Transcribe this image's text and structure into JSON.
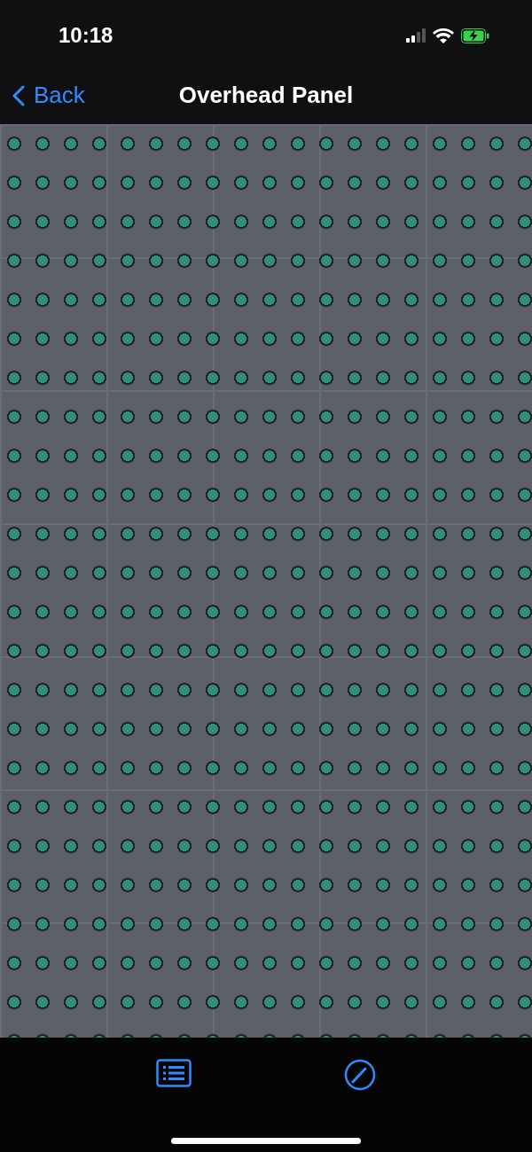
{
  "status_bar": {
    "time": "10:18"
  },
  "nav_bar": {
    "back_label": "Back",
    "title": "Overhead Panel"
  }
}
